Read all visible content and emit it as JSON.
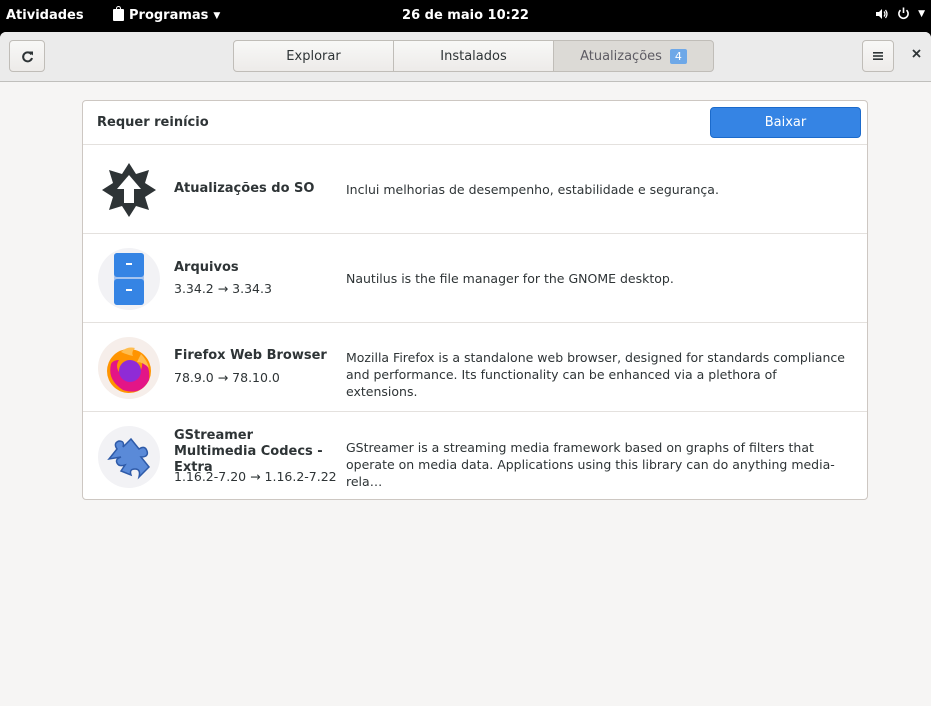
{
  "topbar": {
    "activities": "Atividades",
    "apps_menu": "Programas",
    "clock": "26 de maio 10:22"
  },
  "headerbar": {
    "tabs": [
      {
        "label": "Explorar"
      },
      {
        "label": "Instalados"
      },
      {
        "label": "Atualizações",
        "badge": "4"
      }
    ]
  },
  "updates": {
    "section_title": "Requer reinício",
    "download_label": "Baixar",
    "items": [
      {
        "name": "Atualizações do SO",
        "version": "",
        "description": "Inclui melhorias de desempenho, estabilidade e segurança.",
        "icon": "os-update-icon"
      },
      {
        "name": "Arquivos",
        "version": "3.34.2 → 3.34.3",
        "description": "Nautilus is the file manager for the GNOME desktop.",
        "icon": "files-app-icon"
      },
      {
        "name": "Firefox Web Browser",
        "version": "78.9.0 → 78.10.0",
        "description": "Mozilla Firefox is a standalone web browser, designed for standards compliance and performance.  Its functionality can be enhanced via a plethora of extensions.",
        "icon": "firefox-icon"
      },
      {
        "name": "GStreamer Multimedia Codecs - Extra",
        "version": "1.16.2-7.20 → 1.16.2-7.22",
        "description": "GStreamer is a streaming media framework based on graphs of filters that operate on media data. Applications using this library can do anything media-rela…",
        "icon": "puzzle-piece-icon"
      }
    ]
  },
  "colors": {
    "accent": "#3584e4",
    "badge": "#6ea8e8",
    "topbar": "#000000"
  }
}
